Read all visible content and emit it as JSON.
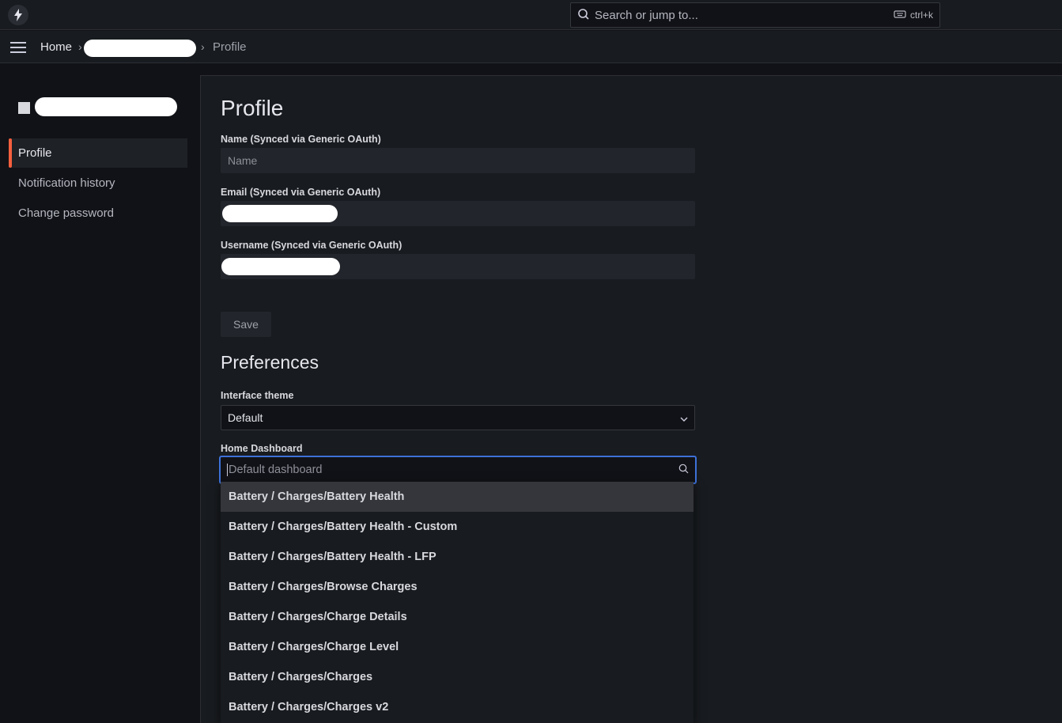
{
  "search": {
    "placeholder": "Search or jump to...",
    "shortcut": "ctrl+k"
  },
  "breadcrumb": {
    "home": "Home",
    "current": "Profile"
  },
  "sidebar": {
    "items": [
      {
        "label": "Profile",
        "active": true
      },
      {
        "label": "Notification history",
        "active": false
      },
      {
        "label": "Change password",
        "active": false
      }
    ]
  },
  "profile": {
    "title": "Profile",
    "name_label": "Name (Synced via Generic OAuth)",
    "name_placeholder": "Name",
    "email_label": "Email (Synced via Generic OAuth)",
    "username_label": "Username (Synced via Generic OAuth)",
    "save_label": "Save"
  },
  "preferences": {
    "title": "Preferences",
    "theme_label": "Interface theme",
    "theme_value": "Default",
    "home_dashboard_label": "Home Dashboard",
    "home_dashboard_placeholder": "Default dashboard"
  },
  "dropdown": {
    "options": [
      "Battery / Charges/Battery Health",
      "Battery / Charges/Battery Health - Custom",
      "Battery / Charges/Battery Health - LFP",
      "Battery / Charges/Browse Charges",
      "Battery / Charges/Charge Details",
      "Battery / Charges/Charge Level",
      "Battery / Charges/Charges",
      "Battery / Charges/Charges v2"
    ],
    "highlighted_index": 0
  },
  "colors": {
    "accent": "#f55f3e",
    "focus": "#3d71d9",
    "background": "#111217",
    "panel": "#181b1f"
  }
}
